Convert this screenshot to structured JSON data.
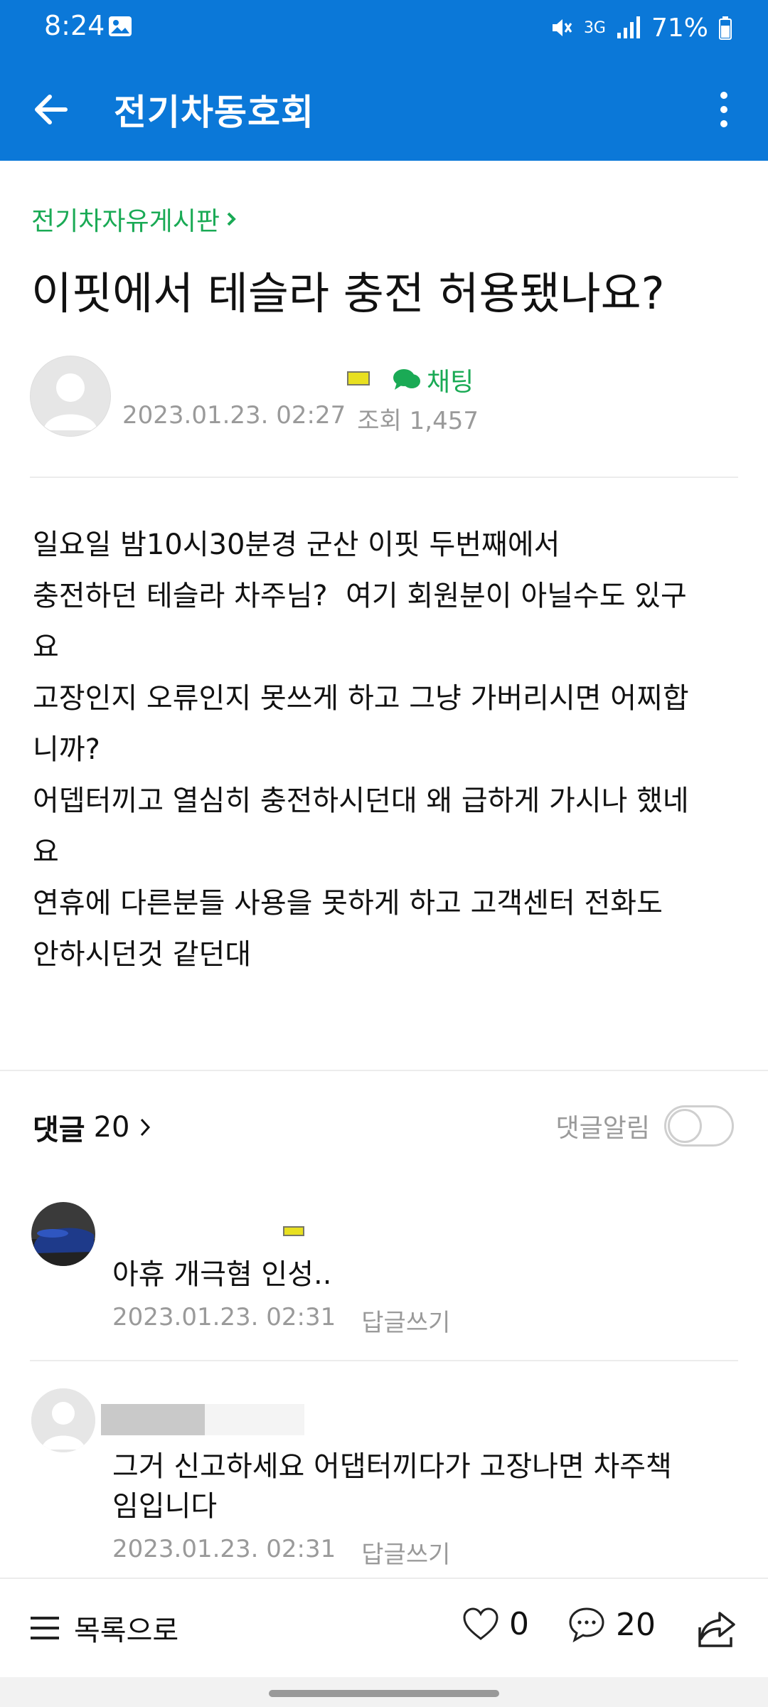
{
  "status_bar": {
    "time": "8:24",
    "network": "3G",
    "battery": "71%"
  },
  "app_bar": {
    "title": "전기차동호회"
  },
  "post": {
    "board": "전기차자유게시판",
    "title": "이핏에서 테슬라 충전 허용됐나요?",
    "chat_label": "채팅",
    "date": "2023.01.23. 02:27",
    "views": "조회 1,457",
    "body_lines": [
      "일요일 밤10시30분경 군산 이핏 두번째에서",
      "충전하던 테슬라 차주님?  여기 회원분이 아닐수도 있구",
      "요",
      "고장인지 오류인지 못쓰게 하고 그냥 가버리시면 어찌합",
      "니까?",
      "어뎁터끼고 열심히 충전하시던대 왜 급하게 가시나 했네",
      "요",
      "연휴에 다른분들 사용을 못하게 하고 고객센터 전화도",
      "안하시던것 같던대"
    ]
  },
  "comments_section": {
    "label": "댓글",
    "count": "20",
    "alarm_label": "댓글알림",
    "alarm_on": false,
    "items": [
      {
        "text": "아휴 개극혐 인성..",
        "date": "2023.01.23. 02:31",
        "reply_label": "답글쓰기"
      },
      {
        "text": "그거 신고하세요 어댑터끼다가 고장나면 차주책\n임입니다",
        "date": "2023.01.23. 02:31",
        "reply_label": "답글쓰기"
      }
    ]
  },
  "bottom_bar": {
    "list_label": "목록으로",
    "like_count": "0",
    "comment_count": "20"
  },
  "colors": {
    "primary": "#0b78d8",
    "accent_green": "#1aaa55",
    "meta_gray": "#9a9a9a"
  }
}
